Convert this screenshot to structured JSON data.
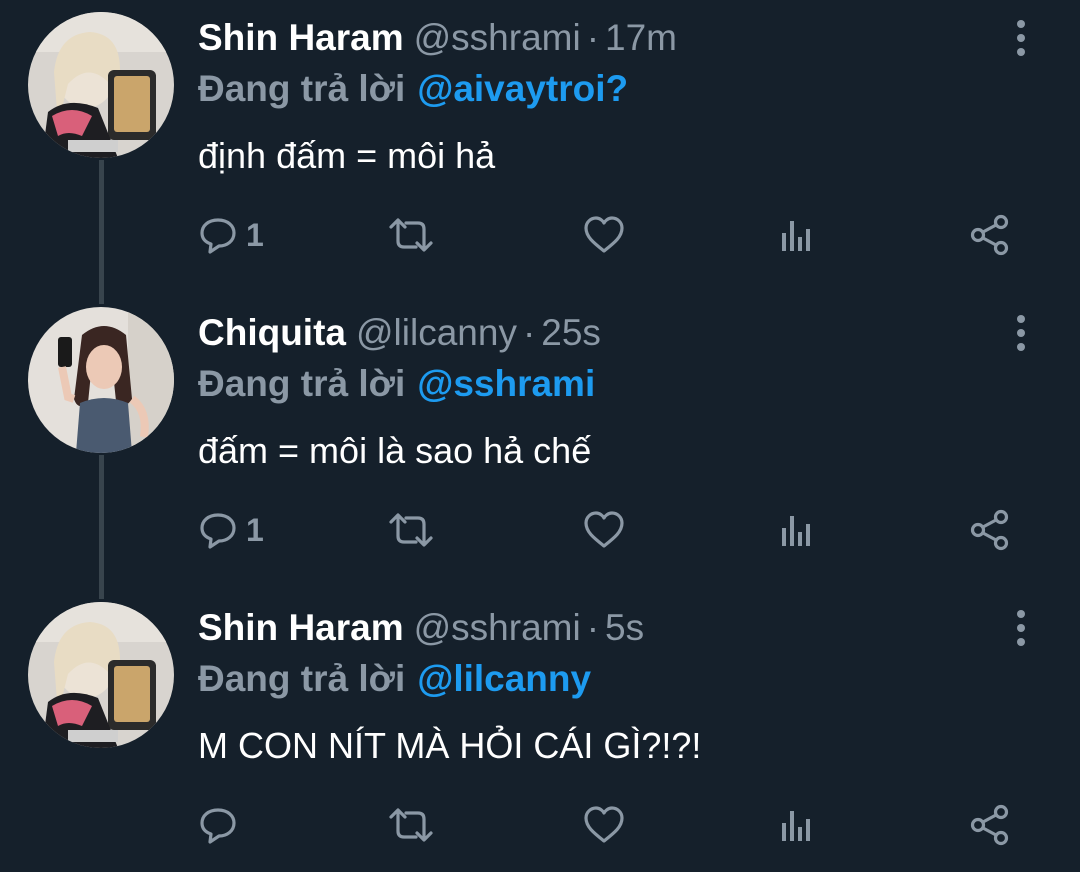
{
  "tweets": [
    {
      "name": "Shin Haram",
      "handle": "@sshrami",
      "separator": "·",
      "time": "17m",
      "reply_label": "Đang trả lời",
      "reply_to": "@aivaytroi?",
      "text": "định đấm = môi hả",
      "reply_count": "1",
      "avatar_icon": "user-avatar-blonde"
    },
    {
      "name": "Chiquita",
      "handle": "@lilcanny",
      "separator": "·",
      "time": "25s",
      "reply_label": "Đang trả lời",
      "reply_to": "@sshrami",
      "text": "đấm = môi là sao hả chế",
      "reply_count": "1",
      "avatar_icon": "user-avatar-darkhair"
    },
    {
      "name": "Shin Haram",
      "handle": "@sshrami",
      "separator": "·",
      "time": "5s",
      "reply_label": "Đang trả lời",
      "reply_to": "@lilcanny",
      "text": "M CON NÍT MÀ HỎI CÁI GÌ?!?!",
      "reply_count": "",
      "avatar_icon": "user-avatar-blonde"
    }
  ],
  "colors": {
    "background": "#15202b",
    "text": "#ffffff",
    "muted": "#8b98a5",
    "accent": "#1d9bf0",
    "thread_line": "#38444d"
  },
  "icons": {
    "reply": "reply-icon",
    "retweet": "retweet-icon",
    "like": "heart-icon",
    "views": "analytics-icon",
    "share": "share-icon",
    "more": "more-options-icon"
  }
}
